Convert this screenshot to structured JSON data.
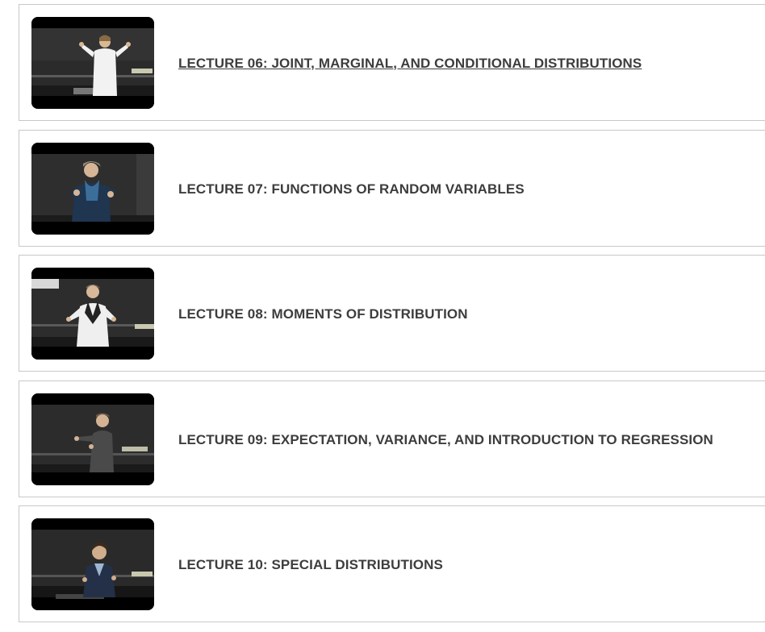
{
  "lectures": [
    {
      "title": "LECTURE 06: JOINT, MARGINAL, AND CONDITIONAL DISTRIBUTIONS",
      "thumbnail": "lecturer-video-thumbnail"
    },
    {
      "title": "LECTURE 07: FUNCTIONS OF RANDOM VARIABLES",
      "thumbnail": "lecturer-video-thumbnail"
    },
    {
      "title": "LECTURE 08: MOMENTS OF DISTRIBUTION",
      "thumbnail": "lecturer-video-thumbnail"
    },
    {
      "title": "LECTURE 09: EXPECTATION, VARIANCE, AND INTRODUCTION TO REGRESSION",
      "thumbnail": "lecturer-video-thumbnail"
    },
    {
      "title": "LECTURE 10: SPECIAL DISTRIBUTIONS",
      "thumbnail": "lecturer-video-thumbnail"
    }
  ]
}
